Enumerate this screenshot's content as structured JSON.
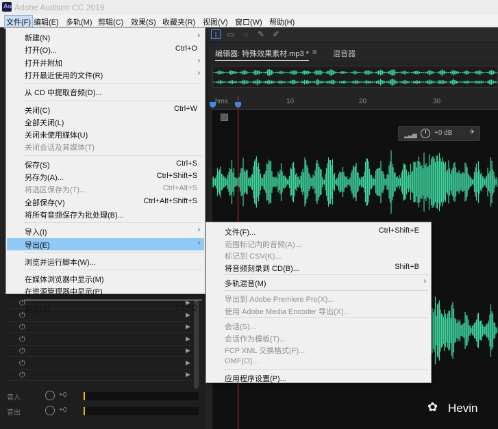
{
  "window": {
    "title": "Adobe Audition CC 2019"
  },
  "menubar": {
    "items": [
      {
        "label": "文件(F)",
        "active": true
      },
      {
        "label": "编辑(E)"
      },
      {
        "label": "多轨(M)"
      },
      {
        "label": "剪辑(C)"
      },
      {
        "label": "效果(S)"
      },
      {
        "label": "收藏夹(R)"
      },
      {
        "label": "视图(V)"
      },
      {
        "label": "窗口(W)"
      },
      {
        "label": "帮助(H)"
      }
    ]
  },
  "file_menu": {
    "items": [
      {
        "label": "新建(N)",
        "submenu": true
      },
      {
        "label": "打开(O)...",
        "shortcut": "Ctrl+O"
      },
      {
        "label": "打开并附加",
        "submenu": true
      },
      {
        "label": "打开最近使用的文件(R)",
        "submenu": true
      },
      {
        "sep": true
      },
      {
        "label": "从 CD 中提取音频(D)..."
      },
      {
        "sep": true
      },
      {
        "label": "关闭(C)",
        "shortcut": "Ctrl+W"
      },
      {
        "label": "全部关闭(L)"
      },
      {
        "label": "关闭未使用媒体(U)"
      },
      {
        "label": "关闭会话及其媒体(T)",
        "disabled": true
      },
      {
        "sep": true
      },
      {
        "label": "保存(S)",
        "shortcut": "Ctrl+S"
      },
      {
        "label": "另存为(A)...",
        "shortcut": "Ctrl+Shift+S"
      },
      {
        "label": "将选区保存为(T)...",
        "shortcut": "Ctrl+Alt+S",
        "disabled": true
      },
      {
        "label": "全部保存(V)",
        "shortcut": "Ctrl+Alt+Shift+S"
      },
      {
        "label": "将所有音频保存为批处理(B)..."
      },
      {
        "sep": true
      },
      {
        "label": "导入(I)",
        "submenu": true
      },
      {
        "label": "导出(E)",
        "submenu": true,
        "highlighted": true
      },
      {
        "sep": true
      },
      {
        "label": "浏览并运行脚本(W)..."
      },
      {
        "sep": true
      },
      {
        "label": "在媒体浏览器中显示(M)"
      },
      {
        "label": "在资源管理器中显示(P)"
      },
      {
        "sep": true
      },
      {
        "label": "退出(X)",
        "shortcut": "Ctrl+Q"
      }
    ]
  },
  "export_menu": {
    "items": [
      {
        "label": "文件(F)...",
        "shortcut": "Ctrl+Shift+E"
      },
      {
        "label": "范围标记内的音频(A)...",
        "disabled": true
      },
      {
        "label": "标记到 CSV(K)...",
        "disabled": true
      },
      {
        "label": "将音频刻录到 CD(B)...",
        "shortcut": "Shift+B"
      },
      {
        "sep": true
      },
      {
        "label": "多轨混音(M)",
        "submenu": true
      },
      {
        "sep": true
      },
      {
        "label": "导出到 Adobe Premiere Pro(X)...",
        "disabled": true
      },
      {
        "label": "使用 Adobe Media Encoder 导出(X)...",
        "disabled": true
      },
      {
        "sep": true
      },
      {
        "label": "会话(S)...",
        "disabled": true
      },
      {
        "label": "会话作为模板(T)...",
        "disabled": true
      },
      {
        "label": "FCP XML 交换格式(F)...",
        "disabled": true
      },
      {
        "label": "OMF(O)...",
        "disabled": true
      },
      {
        "sep": true
      },
      {
        "label": "应用程序设置(P)..."
      }
    ]
  },
  "editor": {
    "tab_active": "编辑器: 特殊效果素材.mp3 *",
    "tab_menu_icon": "hamburger-icon",
    "tab_other": "混音器",
    "ruler": {
      "unit": "hms",
      "ticks": [
        "10",
        "20",
        "30"
      ]
    },
    "volume": {
      "value": "+0 dB"
    }
  },
  "mixer_rows": [
    {
      "label": "音入",
      "value": "+0"
    },
    {
      "label": "音出",
      "value": "+0"
    }
  ],
  "watermark": {
    "text": "Hevin"
  },
  "colors": {
    "waveform": "#3fd6a0",
    "highlight": "#91c9f7",
    "playhead": "#d03030"
  }
}
